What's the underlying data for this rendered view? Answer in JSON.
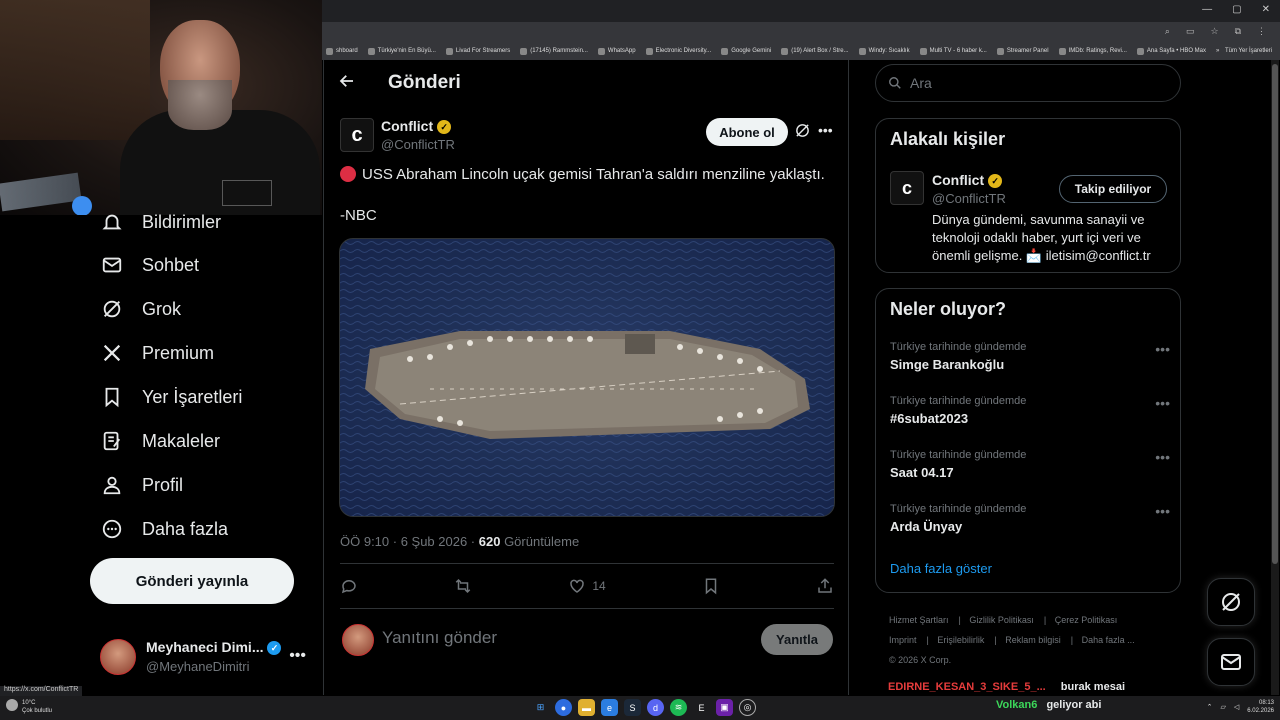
{
  "browser": {
    "bookmarks": [
      "shboard",
      "Türkiye'nin En Büyü...",
      "Livad For Streamers",
      "(17145) Rammstein...",
      "WhatsApp",
      "Electronic Diversity...",
      "Google Gemini",
      "(19) Alert Box / Stre...",
      "Windy: Sıcaklık",
      "Multi TV - 6 haber k...",
      "Streamer Panel",
      "IMDb: Ratings, Revi...",
      "Ana Sayfa • HBO Max"
    ],
    "bookmarks_more": "»",
    "all_bookmarks": "Tüm Yer İşaretleri",
    "status_url": "https://x.com/ConflictTR"
  },
  "nav": {
    "items": [
      {
        "label": "Bildirimler",
        "icon": "bell-icon"
      },
      {
        "label": "Sohbet",
        "icon": "mail-icon"
      },
      {
        "label": "Grok",
        "icon": "grok-icon"
      },
      {
        "label": "Premium",
        "icon": "x-logo-icon"
      },
      {
        "label": "Yer İşaretleri",
        "icon": "bookmark-icon"
      },
      {
        "label": "Makaleler",
        "icon": "article-icon"
      },
      {
        "label": "Profil",
        "icon": "person-icon"
      },
      {
        "label": "Daha fazla",
        "icon": "more-circle-icon"
      }
    ],
    "post_button": "Gönderi yayınla",
    "account": {
      "name": "Meyhaneci Dimi...",
      "handle": "@MeyhaneDimitri",
      "more": "•••"
    }
  },
  "main": {
    "title": "Gönderi",
    "post": {
      "author": "Conflict",
      "handle": "@ConflictTR",
      "follow": "Abone ol",
      "text": "USS Abraham Lincoln uçak gemisi Tahran'a saldırı menziline yaklaştı.",
      "source": "-NBC",
      "time": "ÖÖ 9:10 · 6 Şub 2026 · ",
      "views_count": "620",
      "views_label": " Görüntüleme",
      "likes": "14"
    },
    "reply_placeholder": "Yanıtını gönder",
    "reply_button": "Yanıtla"
  },
  "right": {
    "search_placeholder": "Ara",
    "related": {
      "title": "Alakalı kişiler",
      "name": "Conflict",
      "handle": "@ConflictTR",
      "button": "Takip ediliyor",
      "bio": "Dünya gündemi, savunma sanayii ve teknoloji odaklı haber, yurt içi veri ve önemli gelişme. 📩 iletisim@conflict.tr"
    },
    "trends": {
      "title": "Neler oluyor?",
      "items": [
        {
          "category": "Türkiye tarihinde gündemde",
          "name": "Simge Barankoğlu"
        },
        {
          "category": "Türkiye tarihinde gündemde",
          "name": "#6subat2023"
        },
        {
          "category": "Türkiye tarihinde gündemde",
          "name": "Saat 04.17"
        },
        {
          "category": "Türkiye tarihinde gündemde",
          "name": "Arda Ünyay"
        }
      ],
      "show_more": "Daha fazla göster"
    },
    "footer": {
      "links": [
        "Hizmet Şartları",
        "Gizlilik Politikası",
        "Çerez Politikası",
        "Imprint",
        "Erişilebilirlik",
        "Reklam bilgisi",
        "Daha fazla ..."
      ],
      "copyright": "© 2026 X Corp."
    }
  },
  "chat": {
    "user1": "EDIRNE_KESAN_3_SIKE_5_...",
    "msg1": "burak mesai",
    "user2": "Volkan6",
    "msg2": "geliyor abi"
  },
  "taskbar": {
    "weather_temp": "10°C",
    "weather_desc": "Çok bulutlu",
    "time": "08:13",
    "date": "6.02.2026"
  },
  "colors": {
    "accent": "#1d9bf0",
    "verified_gold": "#e2b719",
    "chat_red": "#e63c3c",
    "chat_green": "#3cd85a"
  }
}
